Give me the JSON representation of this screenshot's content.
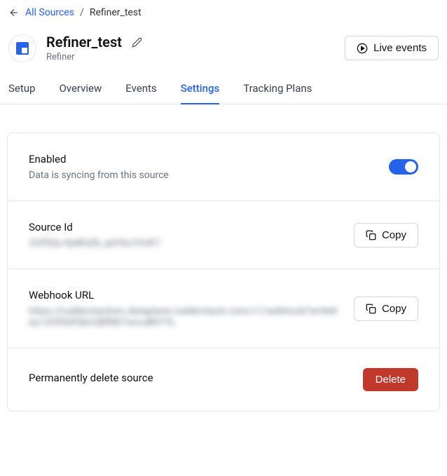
{
  "breadcrumb": {
    "root": "All Sources",
    "current": "Refiner_test"
  },
  "header": {
    "title": "Refiner_test",
    "subtitle": "Refiner",
    "live_events": "Live events"
  },
  "tabs": [
    {
      "label": "Setup",
      "active": false
    },
    {
      "label": "Overview",
      "active": false
    },
    {
      "label": "Events",
      "active": false
    },
    {
      "label": "Settings",
      "active": true
    },
    {
      "label": "Tracking Plans",
      "active": false
    }
  ],
  "settings": {
    "enabled": {
      "title": "Enabled",
      "desc": "Data is syncing from this source",
      "on": true
    },
    "source_id": {
      "title": "Source Id",
      "value": "2GfSQLrfpMUj5LJpH3u1hUK7",
      "copy_label": "Copy"
    },
    "webhook": {
      "title": "Webhook URL",
      "value": "https://rudderstackwc.dataplane.rudderstack.com/v1/webhook?writeKey=2GfSQfQbnQBfMt7xovuBhYYL",
      "copy_label": "Copy"
    },
    "delete": {
      "title": "Permanently delete source",
      "button": "Delete"
    }
  }
}
